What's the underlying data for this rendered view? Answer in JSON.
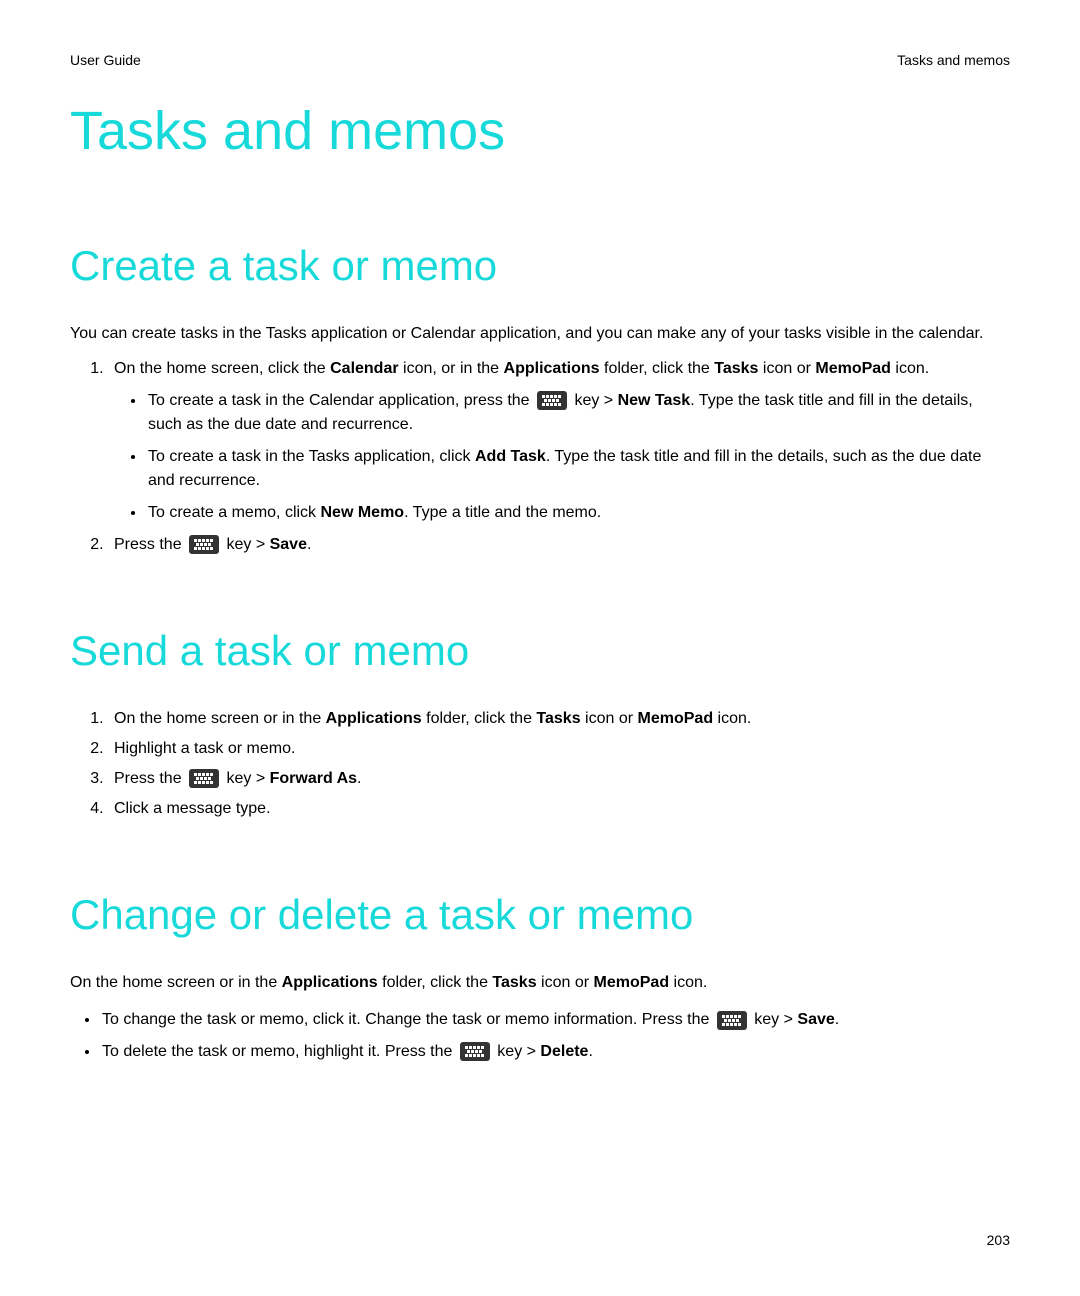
{
  "header": {
    "left": "User Guide",
    "right": "Tasks and memos"
  },
  "page_title": "Tasks and memos",
  "sections": {
    "create": {
      "heading": "Create a task or memo",
      "intro": "You can create tasks in the Tasks application or Calendar application, and you can make any of your tasks visible in the calendar.",
      "step1_pre": "On the home screen, click the ",
      "step1_b1": "Calendar",
      "step1_mid1": " icon, or in the ",
      "step1_b2": "Applications",
      "step1_mid2": " folder, click the ",
      "step1_b3": "Tasks",
      "step1_mid3": " icon or ",
      "step1_b4": "MemoPad",
      "step1_post": " icon.",
      "sub1_pre": "To create a task in the Calendar application, press the ",
      "sub1_key": " key > ",
      "sub1_b": "New Task",
      "sub1_post": ". Type the task title and fill in the details, such as the due date and recurrence.",
      "sub2_pre": "To create a task in the Tasks application, click ",
      "sub2_b": "Add Task",
      "sub2_post": ". Type the task title and fill in the details, such as the due date and recurrence.",
      "sub3_pre": "To create a memo, click ",
      "sub3_b": "New Memo",
      "sub3_post": ". Type a title and the memo.",
      "step2_pre": "Press the ",
      "step2_key": " key > ",
      "step2_b": "Save",
      "step2_post": "."
    },
    "send": {
      "heading": "Send a task or memo",
      "step1_pre": "On the home screen or in the ",
      "step1_b1": "Applications",
      "step1_mid1": " folder, click the ",
      "step1_b2": "Tasks",
      "step1_mid2": " icon or ",
      "step1_b3": "MemoPad",
      "step1_post": " icon.",
      "step2": "Highlight a task or memo.",
      "step3_pre": "Press the ",
      "step3_key": " key > ",
      "step3_b": "Forward As",
      "step3_post": ".",
      "step4": "Click a message type."
    },
    "change": {
      "heading": "Change or delete a task or memo",
      "intro_pre": "On the home screen or in the ",
      "intro_b1": "Applications",
      "intro_mid1": " folder, click the ",
      "intro_b2": "Tasks",
      "intro_mid2": " icon or ",
      "intro_b3": "MemoPad",
      "intro_post": " icon.",
      "b1_pre": "To change the task or memo, click it. Change the task or memo information. Press the ",
      "b1_key": " key > ",
      "b1_b": "Save",
      "b1_post": ".",
      "b2_pre": "To delete the task or memo, highlight it. Press the ",
      "b2_key": " key > ",
      "b2_b": "Delete",
      "b2_post": "."
    }
  },
  "page_number": "203"
}
